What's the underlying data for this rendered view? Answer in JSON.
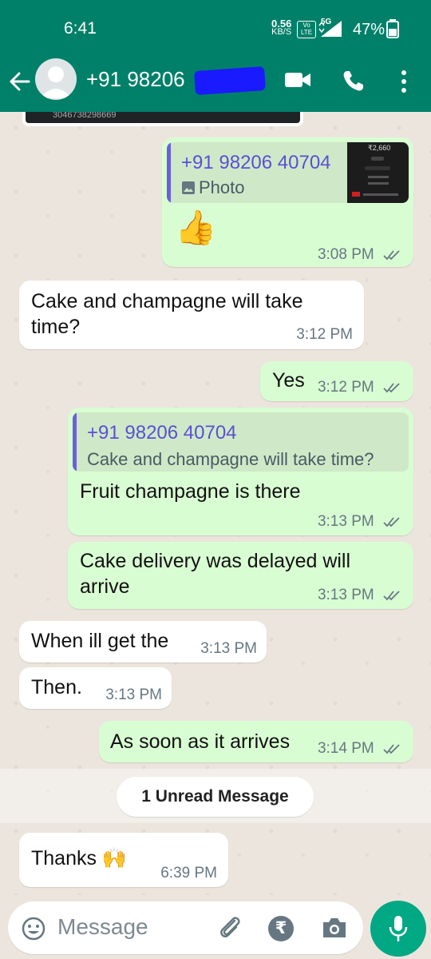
{
  "status_bar": {
    "time": "6:41",
    "net_speed": "0.56",
    "net_unit": "KB/S",
    "volte": "Vo LTE",
    "network": "5G",
    "battery": "47%"
  },
  "header": {
    "contact_name": "+91 98206"
  },
  "top_snippet": "3046738298669",
  "messages": [
    {
      "id": "m1",
      "quote_name": "+91 98206 40704",
      "quote_type": "Photo",
      "thumb_amount": "₹2,660",
      "emoji": "👍",
      "time": "3:08 PM"
    },
    {
      "id": "m2",
      "text_line1": "Cake and champagne will take",
      "text_line2": "time?",
      "time": "3:12 PM"
    },
    {
      "id": "m3",
      "text": "Yes",
      "time": "3:12 PM"
    },
    {
      "id": "m4",
      "quote_name": "+91 98206 40704",
      "quote_text": "Cake and champagne will take time?",
      "text": "Fruit champagne is there",
      "time": "3:13 PM"
    },
    {
      "id": "m5",
      "text_line1": "Cake delivery was delayed will",
      "text_line2": "arrive",
      "time": "3:13 PM"
    },
    {
      "id": "m6",
      "text": "When ill get the",
      "time": "3:13 PM"
    },
    {
      "id": "m7",
      "text": "Then.",
      "time": "3:13 PM"
    },
    {
      "id": "m8",
      "text": "As soon as it arrives",
      "time": "3:14 PM"
    },
    {
      "id": "m9",
      "text": "Thanks 🙌",
      "time": "6:39 PM"
    }
  ],
  "unread_label": "1 Unread Message",
  "composer": {
    "placeholder": "Message",
    "rupee": "₹"
  },
  "colors": {
    "header": "#008069",
    "outgoing": "#d9fdd3",
    "incoming": "#ffffff",
    "accent": "#00a884",
    "ticks": "#667781"
  }
}
